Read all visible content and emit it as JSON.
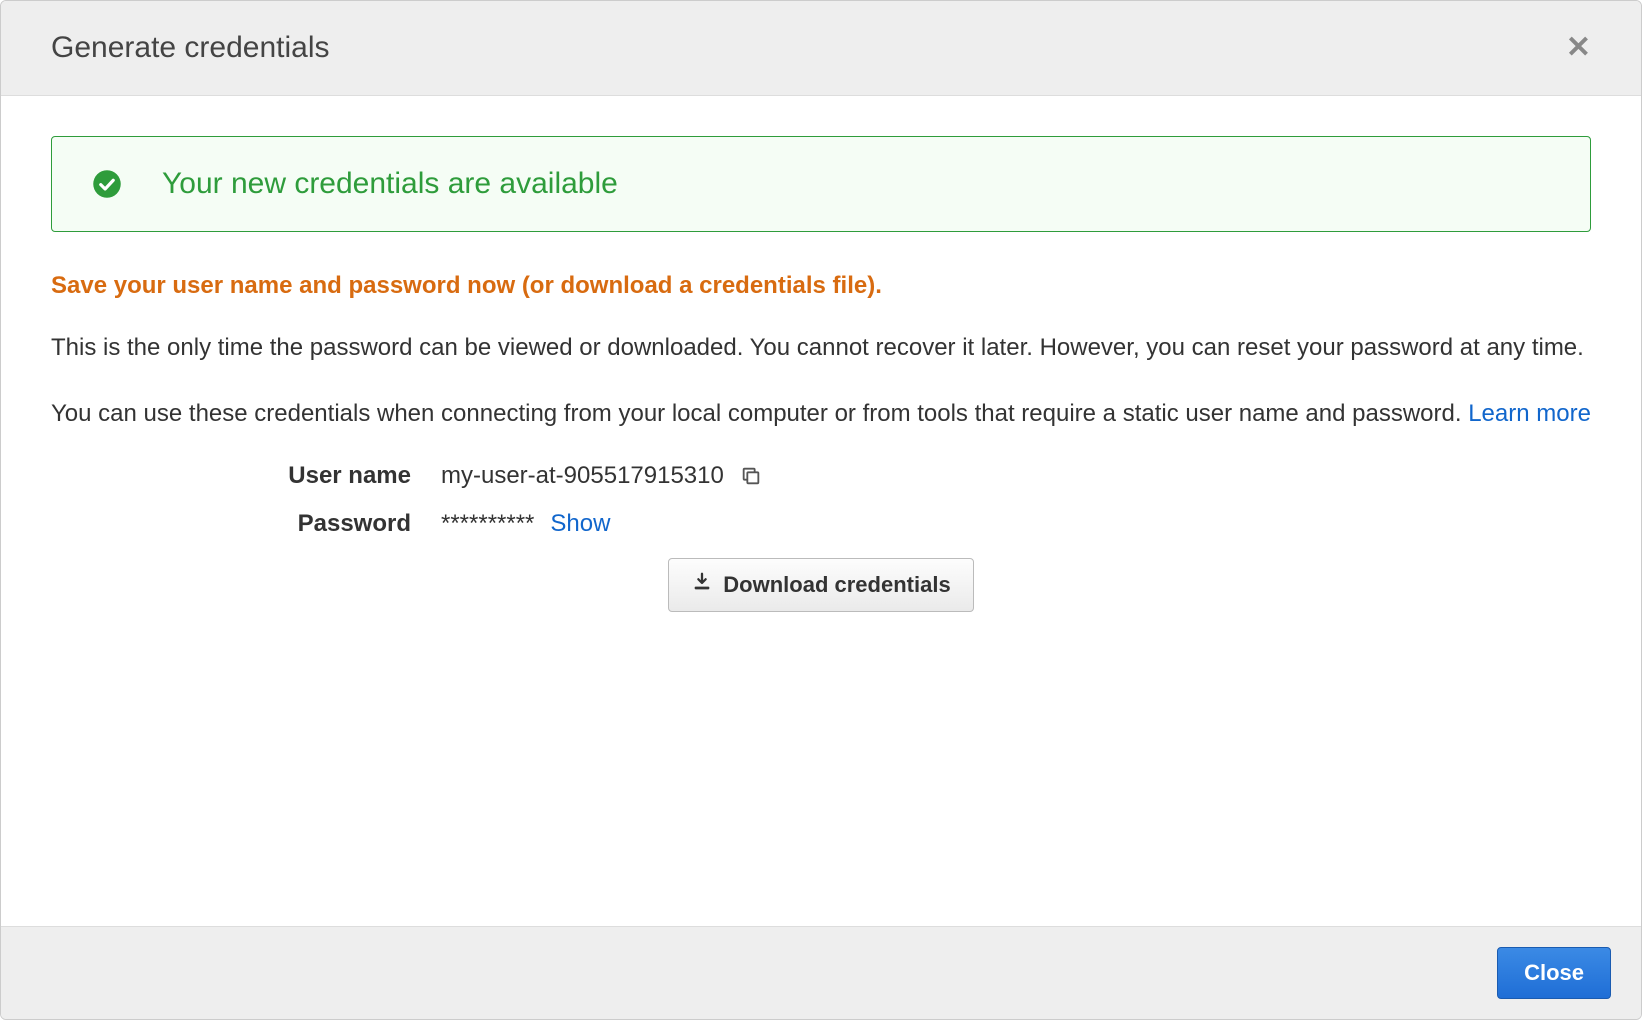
{
  "modal": {
    "title": "Generate credentials",
    "alert": {
      "message": "Your new credentials are available"
    },
    "warning": "Save your user name and password now (or download a credentials file).",
    "paragraph1": "This is the only time the password can be viewed or downloaded. You cannot recover it later. However, you can reset your password at any time.",
    "paragraph2_prefix": "You can use these credentials when connecting from your local computer or from tools that require a static user name and password. ",
    "learn_more": "Learn more",
    "fields": {
      "username_label": "User name",
      "username_value": "my-user-at-905517915310",
      "password_label": "Password",
      "password_masked": "**********",
      "show_label": "Show"
    },
    "download_button": "Download credentials",
    "close_button": "Close"
  }
}
